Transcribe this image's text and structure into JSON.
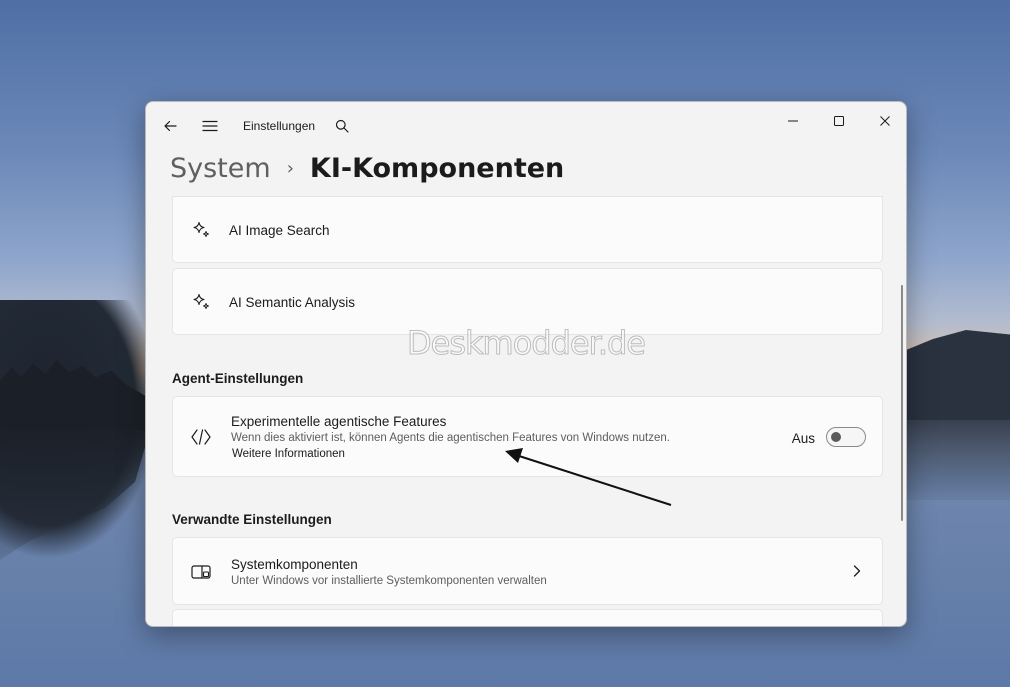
{
  "app": {
    "title": "Einstellungen"
  },
  "breadcrumb": {
    "parent": "System",
    "separator": "›",
    "current": "KI-Komponenten"
  },
  "items": {
    "image_search": {
      "title": "AI Image Search",
      "icon": "sparkle-icon"
    },
    "semantic_analysis": {
      "title": "AI Semantic Analysis",
      "icon": "sparkle-icon"
    }
  },
  "agent_section": {
    "title": "Agent-Einstellungen",
    "feature": {
      "title": "Experimentelle agentische Features",
      "description": "Wenn dies aktiviert ist, können Agents die agentischen Features von Windows nutzen.",
      "link": "Weitere Informationen",
      "toggle_label": "Aus",
      "toggle_on": false,
      "icon": "code-brackets-icon"
    }
  },
  "related_section": {
    "title": "Verwandte Einstellungen",
    "system_components": {
      "title": "Systemkomponenten",
      "description": "Unter Windows vor installierte Systemkomponenten verwalten",
      "icon": "system-components-icon"
    }
  },
  "watermark": "Deskmodder.de",
  "colors": {
    "window_bg": "#f3f3f3",
    "card_bg": "#fbfbfb",
    "text": "#1b1b1b",
    "secondary_text": "#5d5d5d"
  }
}
